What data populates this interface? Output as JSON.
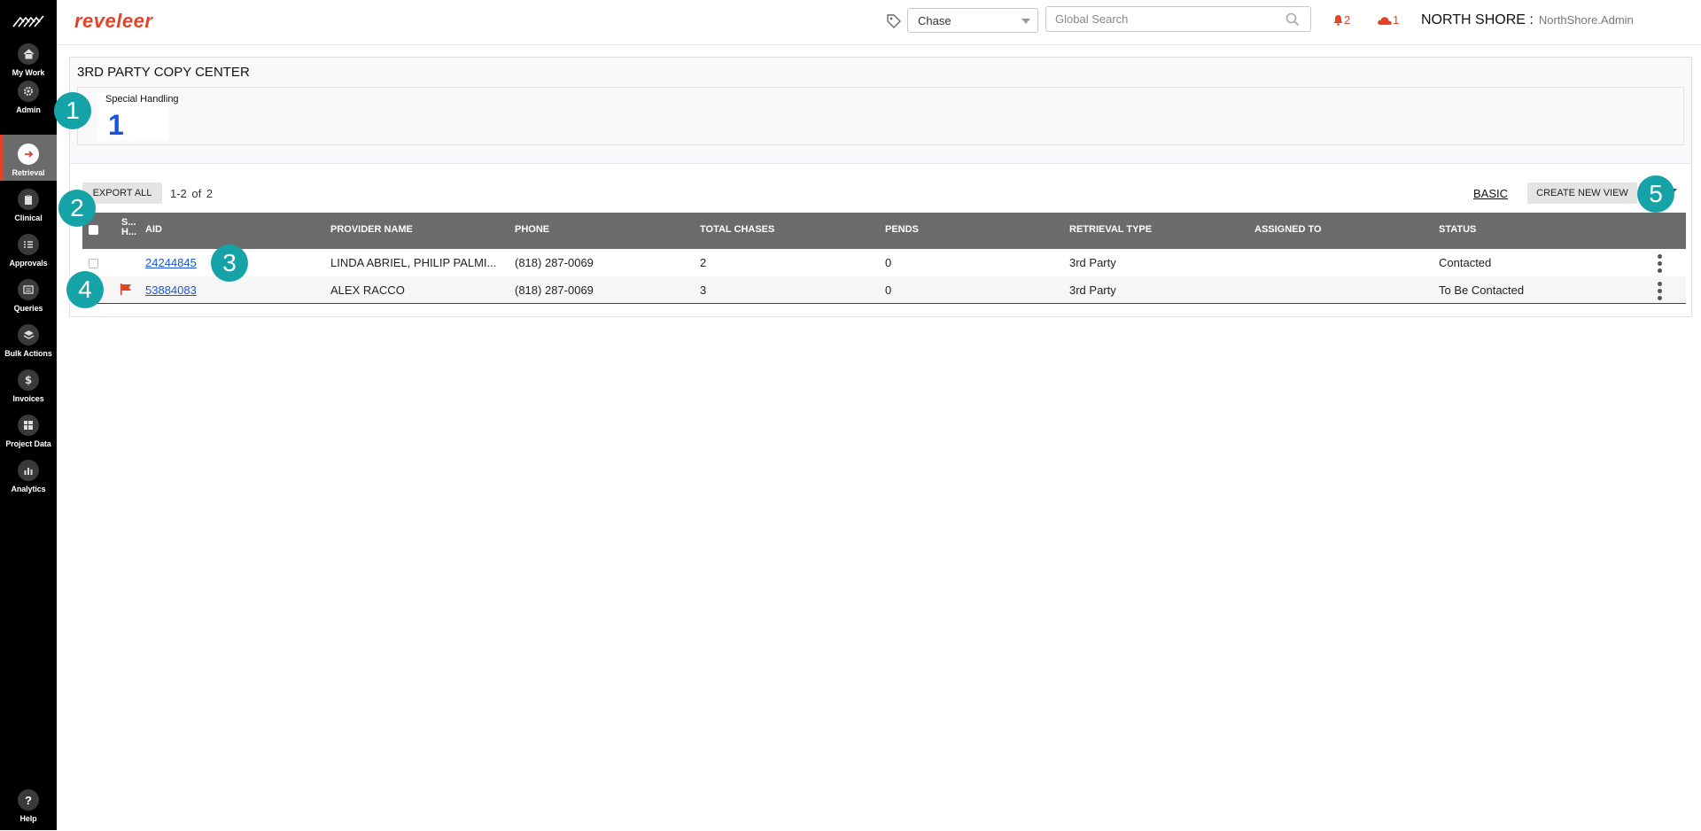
{
  "brand": "reveleer",
  "sidebar": {
    "items": [
      {
        "label": "My Work",
        "icon": "home-icon"
      },
      {
        "label": "Admin",
        "icon": "gear-icon"
      },
      {
        "label": "Retrieval",
        "icon": "arrow-right-icon",
        "active": true
      },
      {
        "label": "Clinical",
        "icon": "clipboard-icon"
      },
      {
        "label": "Approvals",
        "icon": "checklist-icon"
      },
      {
        "label": "Queries",
        "icon": "list-icon"
      },
      {
        "label": "Bulk Actions",
        "icon": "layers-icon"
      },
      {
        "label": "Invoices",
        "icon": "dollar-icon"
      },
      {
        "label": "Project Data",
        "icon": "grid-icon"
      },
      {
        "label": "Analytics",
        "icon": "chart-icon"
      }
    ],
    "help_label": "Help"
  },
  "header": {
    "search_type": "Chase",
    "search_placeholder": "Global Search",
    "notifications_count": "2",
    "cloud_count": "1",
    "org": "NORTH SHORE :",
    "user": "NorthShore.Admin"
  },
  "page": {
    "title": "3RD PARTY COPY CENTER",
    "stat": {
      "label": "Special Handling",
      "value": "1"
    }
  },
  "toolbar": {
    "export_label": "EXPORT ALL",
    "count_text": "1-2  of  2",
    "basic_label": "BASIC",
    "create_view_label": "CREATE NEW VIEW"
  },
  "table": {
    "columns": [
      "S... H...",
      "AID",
      "PROVIDER NAME",
      "PHONE",
      "TOTAL CHASES",
      "PENDS",
      "RETRIEVAL TYPE",
      "ASSIGNED TO",
      "STATUS"
    ],
    "rows": [
      {
        "aid": "24244845",
        "provider": "LINDA ABRIEL, PHILIP PALMI...",
        "phone": "(818) 287-0069",
        "total_chases": "2",
        "pends": "0",
        "retrieval_type": "3rd Party",
        "assigned_to": "",
        "status": "Contacted",
        "flagged": false
      },
      {
        "aid": "53884083",
        "provider": "ALEX RACCO",
        "phone": "(818) 287-0069",
        "total_chases": "3",
        "pends": "0",
        "retrieval_type": "3rd Party",
        "assigned_to": "",
        "status": "To Be Contacted",
        "flagged": true
      }
    ]
  },
  "callouts": [
    "1",
    "2",
    "3",
    "4",
    "5"
  ],
  "colors": {
    "accent": "#e2432a",
    "link": "#1a56db",
    "callout": "#15a3a7",
    "header_row": "#6b6b6b"
  }
}
